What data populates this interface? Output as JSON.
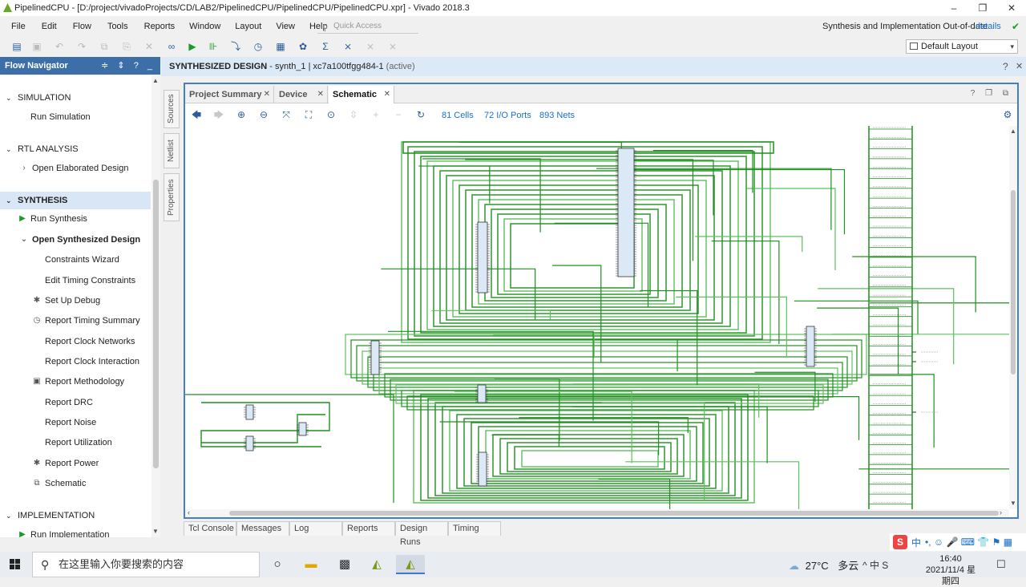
{
  "window": {
    "title": "PipelinedCPU - [D:/project/vivadoProjects/CD/LAB2/PipelinedCPU/PipelinedCPU/PipelinedCPU.xpr] - Vivado 2018.3",
    "minimize": "–",
    "maximize": "❐",
    "close": "✕"
  },
  "menu": {
    "items": [
      "File",
      "Edit",
      "Flow",
      "Tools",
      "Reports",
      "Window",
      "Layout",
      "View",
      "Help"
    ],
    "quick_access_placeholder": "Quick Access",
    "status": "Synthesis and Implementation Out-of-date",
    "details": "details"
  },
  "toolbar": {
    "layout_value": "Default Layout"
  },
  "flow_navigator": {
    "title": "Flow Navigator",
    "header_controls": "≑ ⇕ ? _",
    "sections": [
      {
        "label": "SIMULATION",
        "items": [
          {
            "label": "Run Simulation",
            "icon": ""
          }
        ]
      },
      {
        "label": "RTL ANALYSIS",
        "items": [
          {
            "label": "Open Elaborated Design",
            "icon": "›"
          }
        ]
      },
      {
        "label": "SYNTHESIS",
        "items": [
          {
            "label": "Run Synthesis",
            "icon": "▶"
          },
          {
            "label": "Open Synthesized Design",
            "icon": "⌄"
          },
          {
            "label": "Constraints Wizard",
            "icon": ""
          },
          {
            "label": "Edit Timing Constraints",
            "icon": ""
          },
          {
            "label": "Set Up Debug",
            "icon": "✱"
          },
          {
            "label": "Report Timing Summary",
            "icon": "◷"
          },
          {
            "label": "Report Clock Networks",
            "icon": ""
          },
          {
            "label": "Report Clock Interaction",
            "icon": ""
          },
          {
            "label": "Report Methodology",
            "icon": "▣"
          },
          {
            "label": "Report DRC",
            "icon": ""
          },
          {
            "label": "Report Noise",
            "icon": ""
          },
          {
            "label": "Report Utilization",
            "icon": ""
          },
          {
            "label": "Report Power",
            "icon": "✱"
          },
          {
            "label": "Schematic",
            "icon": "⧉"
          }
        ]
      },
      {
        "label": "IMPLEMENTATION",
        "items": [
          {
            "label": "Run Implementation",
            "icon": "▶"
          }
        ]
      }
    ]
  },
  "side_tabs": [
    "Sources",
    "Netlist",
    "Properties"
  ],
  "design_header": {
    "title": "SYNTHESIZED DESIGN",
    "subtitle": " - synth_1 | xc7a100tfgg484-1",
    "status": "(active)"
  },
  "design_tabs": [
    {
      "label": "Project Summary",
      "active": false
    },
    {
      "label": "Device",
      "active": false
    },
    {
      "label": "Schematic",
      "active": true
    }
  ],
  "schematic_toolbar": {
    "cells": "81 Cells",
    "io_ports": "72 I/O Ports",
    "nets": "893 Nets"
  },
  "bottom_tabs": [
    "Tcl Console",
    "Messages",
    "Log",
    "Reports",
    "Design Runs",
    "Timing"
  ],
  "ime": {
    "logo": "S",
    "mode": "中",
    "icons": "•, ☺ 🎤 ⌨ 👕 ⚑ ▦"
  },
  "taskbar": {
    "search_placeholder": "在这里输入你要搜索的内容",
    "weather_temp": "27°C",
    "weather_desc": "多云",
    "tray": "^ 中 S",
    "time": "16:40",
    "date": "2021/11/4 星期四",
    "notif": "☐"
  },
  "colors": {
    "wire": "#1f8f1f",
    "wire_light": "#5cc05c",
    "accent": "#3c6ea8",
    "link": "#1a6fc9"
  }
}
